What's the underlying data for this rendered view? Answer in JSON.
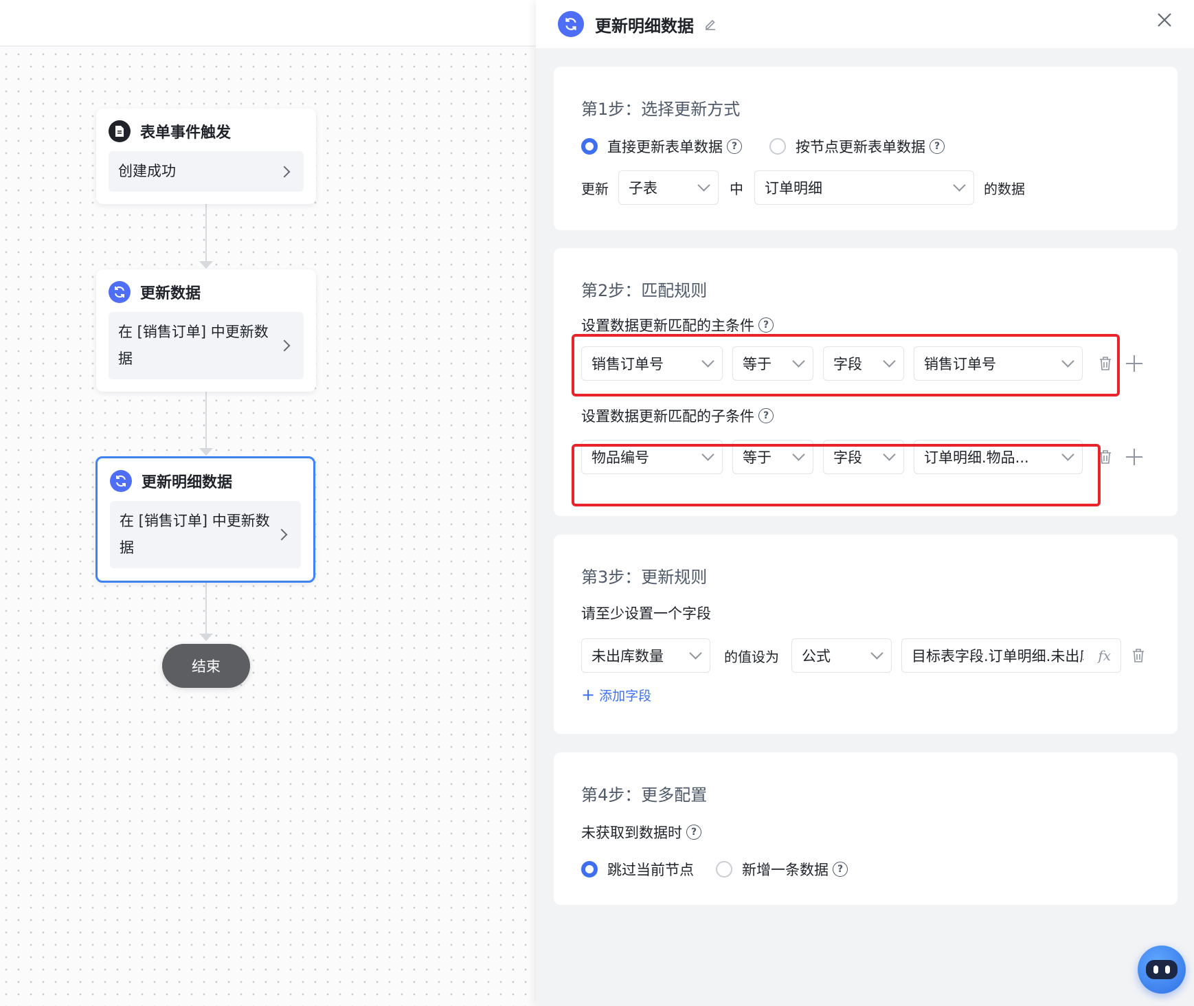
{
  "canvas": {
    "nodes": [
      {
        "title": "表单事件触发",
        "body": "创建成功",
        "icon": "doc-icon"
      },
      {
        "title": "更新数据",
        "body": "在 [销售订单] 中更新数据",
        "icon": "sync-icon"
      },
      {
        "title": "更新明细数据",
        "body": "在 [销售订单] 中更新数据",
        "icon": "sync-icon",
        "selected": true
      }
    ],
    "end_label": "结束"
  },
  "panel": {
    "title": "更新明细数据",
    "step1": {
      "title": "第1步：选择更新方式",
      "option_direct": "直接更新表单数据",
      "option_by_node": "按节点更新表单数据",
      "selected": "direct",
      "update_label": "更新",
      "sub_table_select": "子表",
      "in_label": "中",
      "detail_select": "订单明细",
      "data_suffix": "的数据"
    },
    "step2": {
      "title": "第2步：匹配规则",
      "main_condition_label": "设置数据更新匹配的主条件",
      "main_condition": {
        "field": "销售订单号",
        "operator": "等于",
        "value_type": "字段",
        "value": "销售订单号"
      },
      "sub_condition_label": "设置数据更新匹配的子条件",
      "sub_condition": {
        "field": "物品编号",
        "operator": "等于",
        "value_type": "字段",
        "value": "订单明细.物品..."
      }
    },
    "step3": {
      "title": "第3步：更新规则",
      "hint": "请至少设置一个字段",
      "field": "未出库数量",
      "set_label": "的值设为",
      "mode": "公式",
      "formula": "目标表字段.订单明细.未出库",
      "fx": "fx",
      "add_field": "添加字段"
    },
    "step4": {
      "title": "第4步：更多配置",
      "no_data_label": "未获取到数据时",
      "option_skip": "跳过当前节点",
      "option_add": "新增一条数据",
      "selected": "skip"
    }
  },
  "colors": {
    "accent": "#3d6ff0",
    "highlight": "#e8232a",
    "node_icon": "#4f6ef7"
  }
}
